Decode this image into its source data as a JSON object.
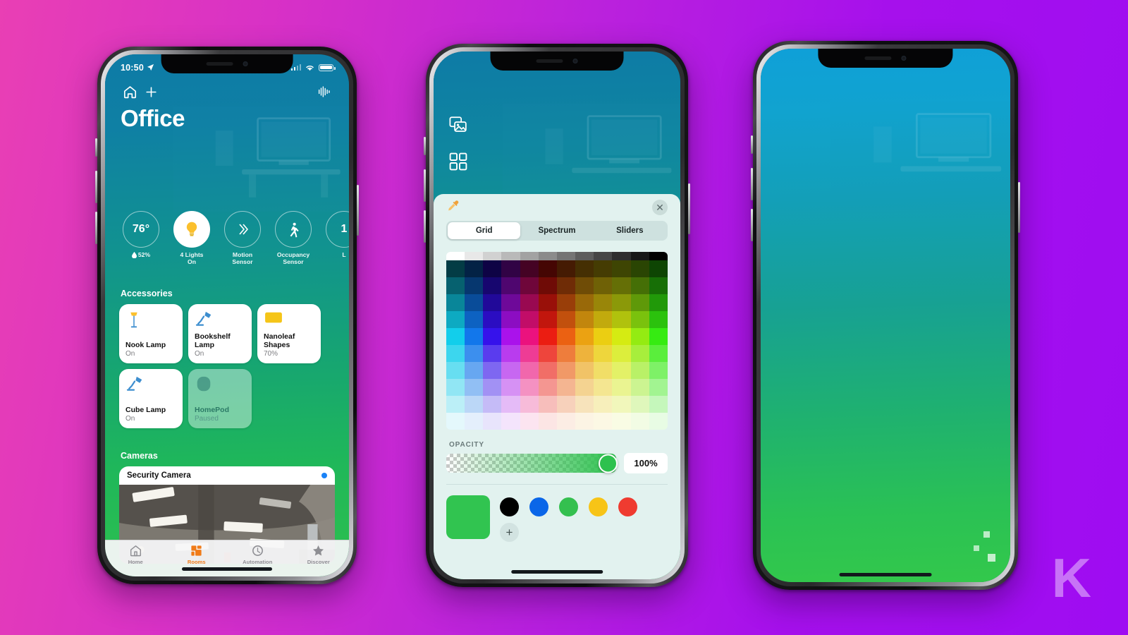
{
  "background": {
    "from": "#e93fb4",
    "to": "#9e0cf2"
  },
  "watermark": "K",
  "phone1": {
    "status_bar": {
      "time": "10:50",
      "location_icon": "location-arrow-icon",
      "signal_icon": "cellular-bars-icon",
      "wifi_icon": "wifi-icon",
      "battery_icon": "battery-icon"
    },
    "top_bar": {
      "home_icon": "home-icon",
      "add_icon": "plus-icon",
      "speaker_icon": "audio-waveform-icon"
    },
    "title": "Office",
    "status_items": [
      {
        "name": "climate",
        "value": "76°",
        "label": "52%",
        "sub_icon": "humidity-drop-icon",
        "active": false
      },
      {
        "name": "lights",
        "icon": "lightbulb-icon",
        "label": "4 Lights\nOn",
        "active": true
      },
      {
        "name": "motion-sensor",
        "icon": "motion-sensor-icon",
        "label": "Motion Sensor",
        "active": false
      },
      {
        "name": "occupancy-sensor",
        "icon": "walking-person-icon",
        "label": "Occupancy\nSensor",
        "active": false
      },
      {
        "name": "partial",
        "value": "1",
        "label": "L",
        "active": false
      }
    ],
    "accessories_title": "Accessories",
    "accessories": [
      {
        "name": "Nook Lamp",
        "state": "On",
        "icon": "floor-lamp-icon",
        "dim": false
      },
      {
        "name": "Bookshelf Lamp",
        "state": "On",
        "icon": "desk-lamp-icon",
        "dim": false
      },
      {
        "name": "Nanoleaf Shapes",
        "state": "70%",
        "icon": "light-panel-icon",
        "dim": false
      },
      {
        "name": "Cube Lamp",
        "state": "On",
        "icon": "desk-lamp-icon",
        "dim": false
      },
      {
        "name": "HomePod",
        "state": "Paused",
        "icon": "homepod-icon",
        "dim": true
      }
    ],
    "cameras_title": "Cameras",
    "camera": {
      "name": "Security Camera",
      "status_dot_color": "#1a82f7"
    },
    "tabs": [
      {
        "label": "Home",
        "icon": "home-outline-icon",
        "active": false
      },
      {
        "label": "Rooms",
        "icon": "rooms-icon",
        "active": true
      },
      {
        "label": "Automation",
        "icon": "automation-clock-icon",
        "active": false
      },
      {
        "label": "Discover",
        "icon": "star-icon",
        "active": false
      }
    ]
  },
  "phone2": {
    "tools": [
      {
        "name": "wallpaper-icon"
      },
      {
        "name": "grid-four-squares-icon"
      }
    ],
    "sheet": {
      "eyedropper_icon": "eyedropper-icon",
      "close_icon": "close-x-icon",
      "tabs": [
        {
          "label": "Grid",
          "active": true
        },
        {
          "label": "Spectrum",
          "active": false
        },
        {
          "label": "Sliders",
          "active": false
        }
      ],
      "opacity_label": "OPACITY",
      "opacity_value": "100%",
      "opacity_percent": 100,
      "selected_color": "#31c450",
      "swatches": [
        {
          "name": "black",
          "color": "#000000"
        },
        {
          "name": "blue",
          "color": "#0a66e8"
        },
        {
          "name": "green",
          "color": "#34c04f"
        },
        {
          "name": "yellow",
          "color": "#f7c417"
        },
        {
          "name": "red",
          "color": "#ef3b30"
        }
      ],
      "add_swatch_label": "+"
    }
  },
  "phone3": {
    "wallpaper_from": "#0fa0d8",
    "wallpaper_to": "#33c84b"
  }
}
